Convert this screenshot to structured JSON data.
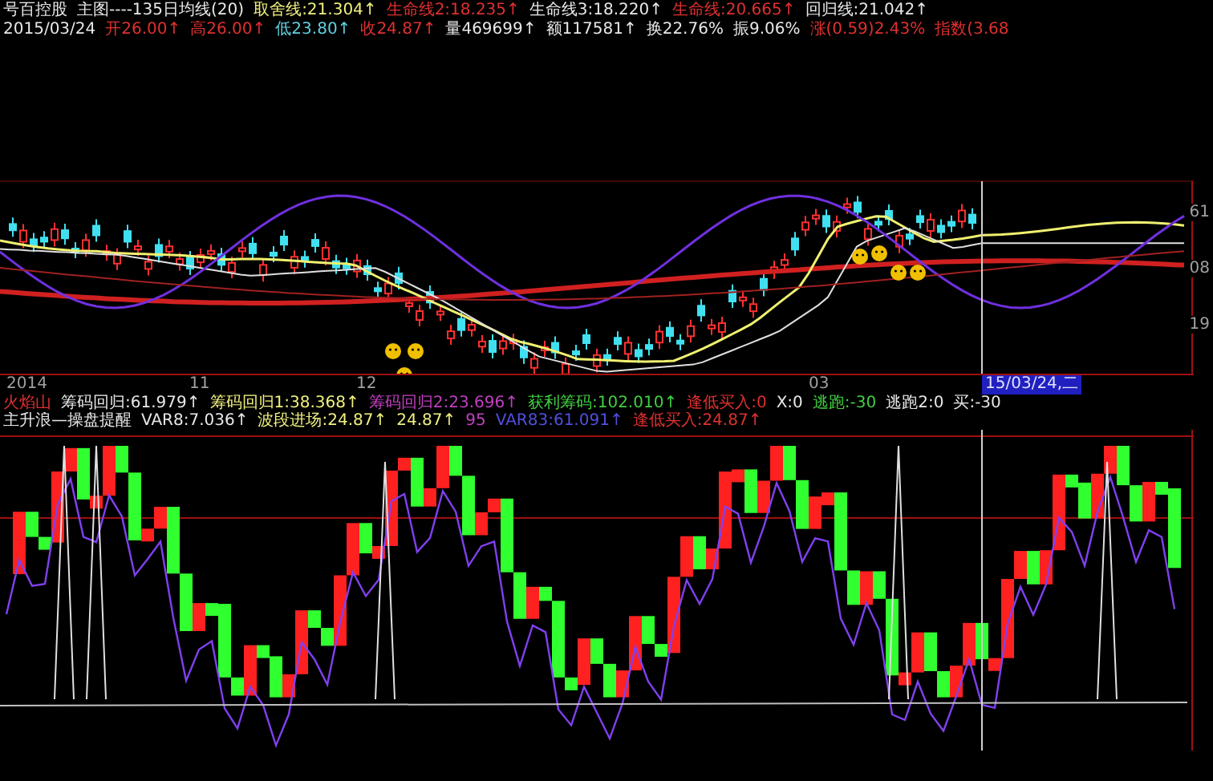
{
  "header": {
    "line1": [
      {
        "text": "号百控股",
        "color": "#e8e8e8"
      },
      {
        "text": "主图----135日均线(20)",
        "color": "#e8e8e8"
      },
      {
        "text": "取舍线:21.304↑",
        "color": "#f0f080"
      },
      {
        "text": "生命线2:18.235↑",
        "color": "#e03030"
      },
      {
        "text": "生命线3:18.220↑",
        "color": "#e8e8e8"
      },
      {
        "text": "生命线:20.665↑",
        "color": "#e03030"
      },
      {
        "text": "回归线:21.042↑",
        "color": "#e8e8e8"
      }
    ],
    "line2": [
      {
        "text": "2015/03/24",
        "color": "#e8e8e8"
      },
      {
        "text": "开26.00↑",
        "color": "#e03030"
      },
      {
        "text": "高26.00↑",
        "color": "#e03030"
      },
      {
        "text": "低23.80↑",
        "color": "#60d0e0"
      },
      {
        "text": "收24.87↑",
        "color": "#e03030"
      },
      {
        "text": "量469699↑",
        "color": "#e8e8e8"
      },
      {
        "text": "额117581↑",
        "color": "#e8e8e8"
      },
      {
        "text": "换22.76%",
        "color": "#e8e8e8"
      },
      {
        "text": "振9.06%",
        "color": "#e8e8e8"
      },
      {
        "text": "涨(0.59)2.43%",
        "color": "#e03030"
      },
      {
        "text": "指数(3.68",
        "color": "#e03030"
      }
    ]
  },
  "price_axis": [
    "61",
    "08",
    "19"
  ],
  "date_axis": {
    "labels": [
      "2014",
      "11",
      "12",
      "03"
    ],
    "cursor_date": "15/03/24,二"
  },
  "indicator": {
    "line1": [
      {
        "text": "火焰山",
        "color": "#e03030"
      },
      {
        "text": "筹码回归:61.979↑",
        "color": "#e8e8e8"
      },
      {
        "text": "筹码回归1:38.368↑",
        "color": "#f0f080"
      },
      {
        "text": "筹码回归2:23.696↑",
        "color": "#c040c0"
      },
      {
        "text": "获利筹码:102.010↑",
        "color": "#40d040"
      },
      {
        "text": "逢低买入:0",
        "color": "#e03030"
      },
      {
        "text": "X:0",
        "color": "#e8e8e8"
      },
      {
        "text": "逃跑:-30",
        "color": "#40d040"
      },
      {
        "text": "逃跑2:0",
        "color": "#e8e8e8"
      },
      {
        "text": "买:-30",
        "color": "#e8e8e8"
      }
    ],
    "line2": [
      {
        "text": "主升浪—操盘提醒",
        "color": "#e8e8e8"
      },
      {
        "text": "VAR8:7.036↑",
        "color": "#e8e8e8"
      },
      {
        "text": "波段进场:24.87↑",
        "color": "#f0f080"
      },
      {
        "text": "24.87↑",
        "color": "#f0f080"
      },
      {
        "text": "95",
        "color": "#c040c0"
      },
      {
        "text": "VAR83:61.091↑",
        "color": "#5050e0"
      },
      {
        "text": "逢低买入:24.87↑",
        "color": "#e03030"
      }
    ]
  }
}
